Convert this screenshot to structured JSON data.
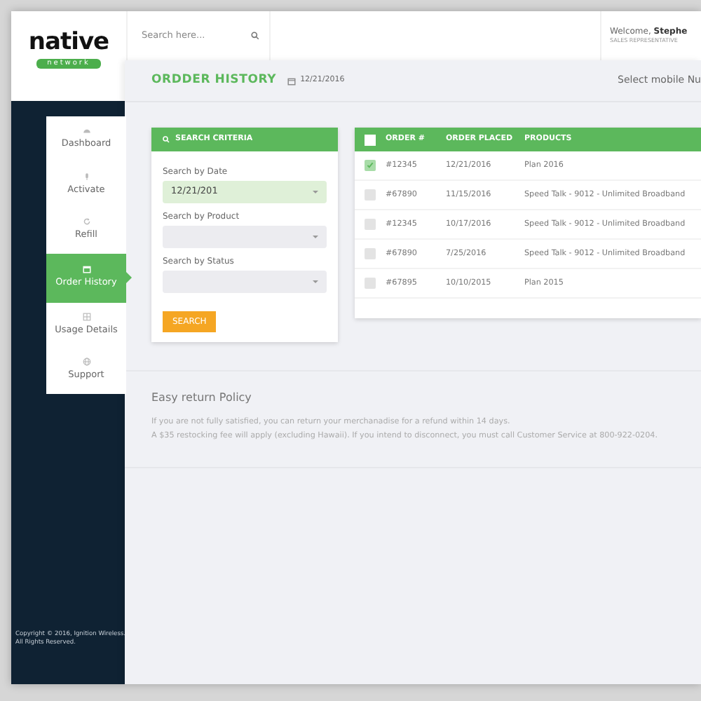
{
  "logo": {
    "word": "native",
    "tag": "network"
  },
  "search": {
    "placeholder": "Search here..."
  },
  "user": {
    "greeting": "Welcome,",
    "name": "Stephe",
    "role": "SALES REPRESENTATIVE"
  },
  "sidebar": {
    "items": [
      {
        "label": "Dashboard",
        "kind": "gauge",
        "selected": false
      },
      {
        "label": "Activate",
        "kind": "mic",
        "selected": false
      },
      {
        "label": "Refill",
        "kind": "refresh",
        "selected": false
      },
      {
        "label": "Order History",
        "kind": "calendar",
        "selected": true
      },
      {
        "label": "Usage Details",
        "kind": "grid",
        "selected": false
      },
      {
        "label": "Support",
        "kind": "globe",
        "selected": false
      }
    ]
  },
  "page": {
    "title": "ORDDER HISTORY",
    "date": "12/21/2016",
    "mobile_select": "Select mobile Nu"
  },
  "search_criteria": {
    "title": "SEARCH CRITERIA",
    "fields": [
      {
        "label": "Search by Date",
        "value": "12/21/201",
        "active": true
      },
      {
        "label": "Search by Product",
        "active": false
      },
      {
        "label": "Search by Status",
        "active": false
      }
    ],
    "button": "SEARCH"
  },
  "table": {
    "select_all": false,
    "columns": [
      "ORDER #",
      "ORDER PLACED",
      "PRODUCTS"
    ],
    "rows": [
      {
        "checked": true,
        "cells": [
          "#12345",
          "12/21/2016",
          "Plan 2016"
        ]
      },
      {
        "checked": false,
        "cells": [
          "#67890",
          "11/15/2016",
          "Speed Talk - 9012 - Unlimited Broadband"
        ]
      },
      {
        "checked": false,
        "cells": [
          "#12345",
          "10/17/2016",
          "Speed Talk - 9012 - Unlimited Broadband"
        ]
      },
      {
        "checked": false,
        "cells": [
          "#67890",
          "7/25/2016",
          "Speed Talk - 9012 - Unlimited Broadband"
        ]
      },
      {
        "checked": false,
        "cells": [
          "#67895",
          "10/10/2015",
          "Plan 2015"
        ]
      }
    ]
  },
  "policy": {
    "title": "Easy return Policy",
    "lines": [
      "If you are not fully satisfied, you can return your merchanadise for a refund within 14 days.",
      "A $35 restocking fee will apply (excluding Hawaii). If you intend to disconnect, you must call Customer Service at 800-922-0204."
    ]
  },
  "footer": {
    "lines": [
      "Copyright © 2016, Ignition Wireless.",
      "All Rights Reserved."
    ]
  }
}
